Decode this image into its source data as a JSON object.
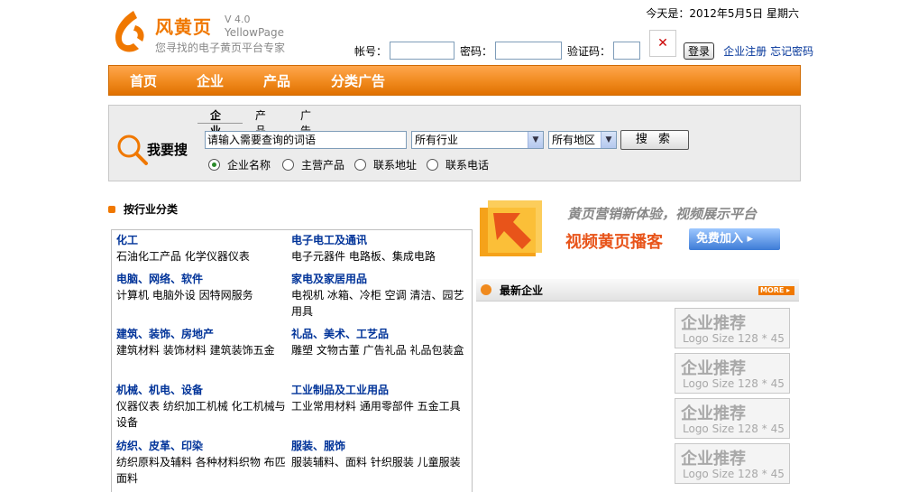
{
  "header": {
    "logo_text": "风黄页",
    "version": "V 4.0",
    "logo_en": "YellowPage",
    "slogan": "您寻找的电子黄页平台专家",
    "date": "今天是：2012年5月5日  星期六",
    "login": {
      "account_label": "帐号：",
      "password_label": "密码：",
      "captcha_label": "验证码：",
      "login_button": "登录",
      "register_link": "企业注册",
      "forgot_link": "忘记密码"
    }
  },
  "nav": {
    "items": [
      "首页",
      "企业",
      "产品",
      "分类广告"
    ]
  },
  "search": {
    "tabs": [
      "企业",
      "产品",
      "广告"
    ],
    "label": "我要搜",
    "keyword_value": "请输入需要查询的词语",
    "industry_select": "所有行业",
    "region_select": "所有地区",
    "search_button": "搜 索",
    "radios": [
      "企业名称",
      "主营产品",
      "联系地址",
      "联系电话"
    ]
  },
  "categories": {
    "heading": "按行业分类",
    "items": [
      {
        "title": "化工",
        "text": "石油化工产品  化学仪器仪表"
      },
      {
        "title": "电子电工及通讯",
        "text": "电子元器件  电路板、集成电路"
      },
      {
        "title": "电脑、网络、软件",
        "text": "计算机  电脑外设  因特网服务"
      },
      {
        "title": "家电及家居用品",
        "text": "电视机  冰箱、冷柜  空调  清洁、园艺用具"
      },
      {
        "title": "建筑、装饰、房地产",
        "text": "建筑材料  装饰材料  建筑装饰五金"
      },
      {
        "title": "礼品、美术、工艺品",
        "text": "雕塑  文物古董  广告礼品  礼品包装盒"
      },
      {
        "title": "机械、机电、设备",
        "text": "仪器仪表  纺织加工机械  化工机械与设备"
      },
      {
        "title": "工业制品及工业用品",
        "text": "工业常用材料  通用零部件  五金工具"
      },
      {
        "title": "纺织、皮革、印染",
        "text": "纺织原料及辅料  各种材料织物  布匹面料"
      },
      {
        "title": "服装、服饰",
        "text": "服装辅料、面料  针织服装  儿童服装"
      }
    ]
  },
  "banner": {
    "slogan": "黄页营销新体验，视频展示平台",
    "title": "视频黄页播客",
    "button": "免费加入 ▸"
  },
  "latest": {
    "heading": "最新企业",
    "more": "MORE ▸",
    "recommend": [
      {
        "title": "企业推荐",
        "size": "Logo Size 128 * 45"
      },
      {
        "title": "企业推荐",
        "size": "Logo Size 128 * 45"
      },
      {
        "title": "企业推荐",
        "size": "Logo Size 128 * 45"
      },
      {
        "title": "企业推荐",
        "size": "Logo Size 128 * 45"
      }
    ]
  },
  "colors": {
    "accent": "#f08a1e",
    "link": "#003399"
  }
}
